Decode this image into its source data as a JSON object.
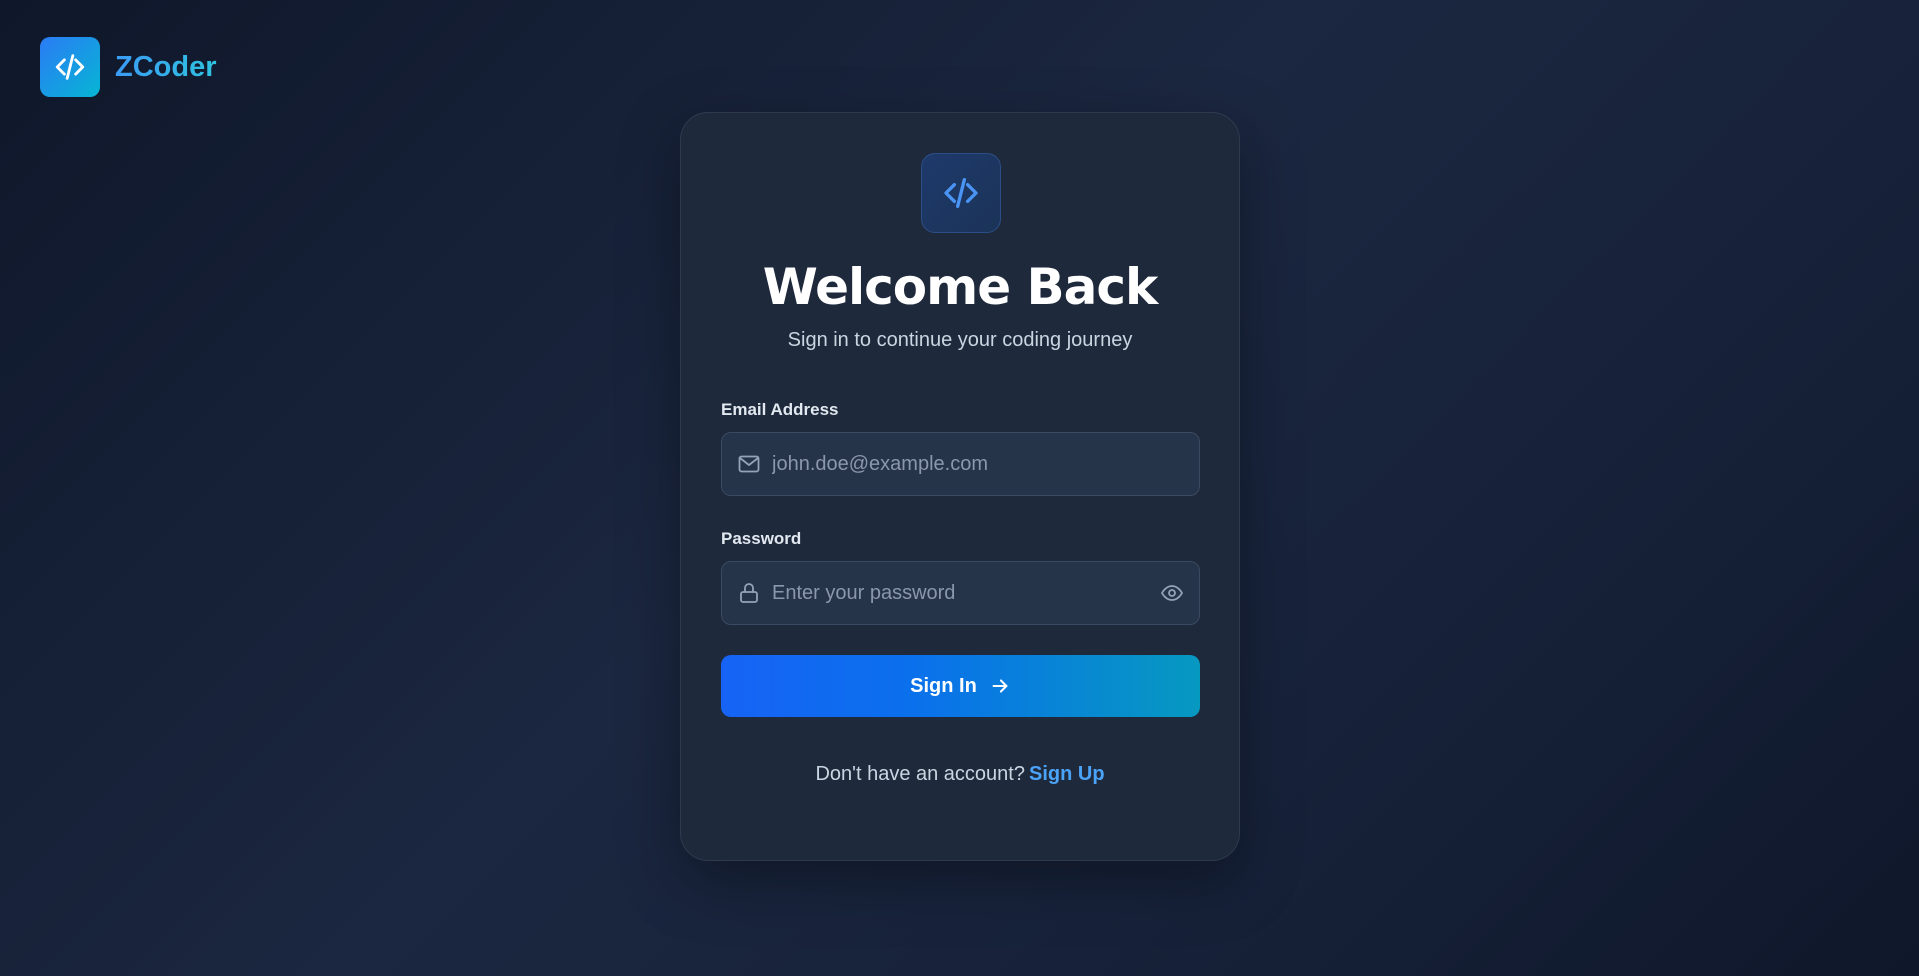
{
  "brand": {
    "name": "ZCoder",
    "icon": "code-icon"
  },
  "card": {
    "icon": "code-icon",
    "title": "Welcome Back",
    "subtitle": "Sign in to continue your coding journey"
  },
  "form": {
    "email": {
      "label": "Email Address",
      "placeholder": "john.doe@example.com",
      "value": "",
      "icon": "mail-icon"
    },
    "password": {
      "label": "Password",
      "placeholder": "Enter your password",
      "value": "",
      "icon": "lock-icon",
      "toggle_icon": "eye-icon"
    },
    "submit_label": "Sign In",
    "submit_icon": "arrow-right-icon"
  },
  "footer": {
    "prompt": "Don't have an account?",
    "link_label": "Sign Up"
  },
  "colors": {
    "accent": "#1763f5",
    "accent_end": "#0699c0",
    "link": "#4ba3f7",
    "card_bg": "#1e293b",
    "page_bg": "#0f172a"
  }
}
